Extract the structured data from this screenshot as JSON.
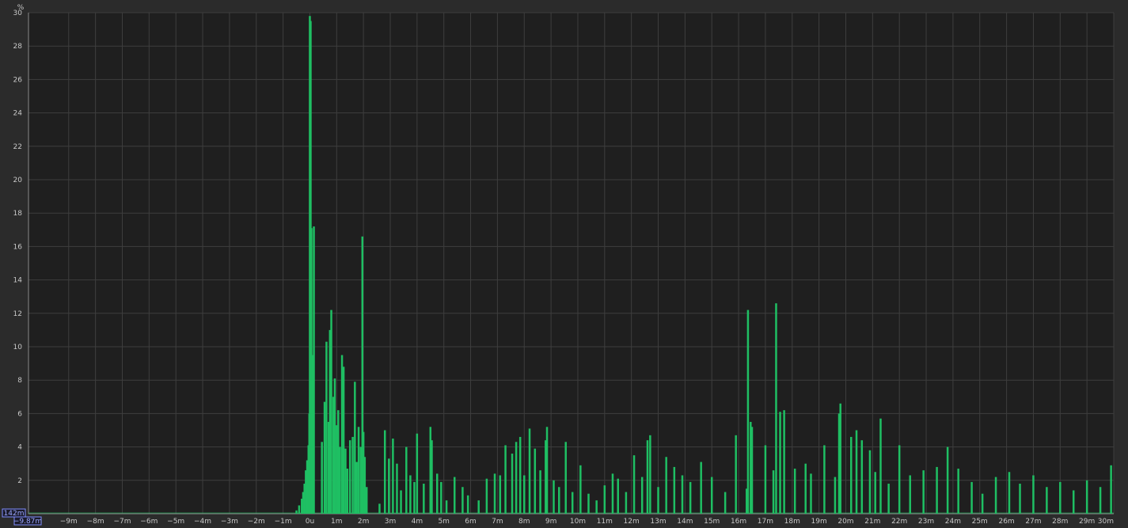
{
  "colors": {
    "background": "#2b2b2b",
    "plot_background": "#1f1f1f",
    "grid": "#3e3e3e",
    "trace": "#1fbf63",
    "cursor": "#7f8cff"
  },
  "readouts": {
    "y_cursor": "142m",
    "x_cursor": "−9.87m"
  },
  "chart_data": {
    "type": "bar",
    "title": "",
    "xlabel": "",
    "ylabel": "%",
    "xlim": [
      -10.5,
      30.0
    ],
    "ylim": [
      0,
      30
    ],
    "grid": true,
    "y_ticks": [
      2,
      4,
      6,
      8,
      10,
      12,
      14,
      16,
      18,
      20,
      22,
      24,
      26,
      28,
      30
    ],
    "x_tick_values": [
      -9,
      -8,
      -7,
      -6,
      -5,
      -4,
      -3,
      -2,
      -1,
      0,
      1,
      2,
      3,
      4,
      5,
      6,
      7,
      8,
      9,
      10,
      11,
      12,
      13,
      14,
      15,
      16,
      17,
      18,
      19,
      20,
      21,
      22,
      23,
      24,
      25,
      26,
      27,
      28,
      29,
      30
    ],
    "x_tick_labels": [
      "−9m",
      "−8m",
      "−7m",
      "−6m",
      "−5m",
      "−4m",
      "−3m",
      "−2m",
      "−1m",
      "0u",
      "1m",
      "2m",
      "3m",
      "4m",
      "5m",
      "6m",
      "7m",
      "8m",
      "9m",
      "10m",
      "11m",
      "12m",
      "13m",
      "14m",
      "15m",
      "16m",
      "17m",
      "18m",
      "19m",
      "20m",
      "21m",
      "22m",
      "23m",
      "24m",
      "25m",
      "26m",
      "27m",
      "28m",
      "29m",
      "30m"
    ],
    "series": [
      {
        "x": [
          -0.5,
          -0.4,
          -0.3,
          -0.25,
          -0.2,
          -0.15,
          -0.1,
          -0.05,
          -0.02,
          0.0,
          0.03,
          0.06,
          0.1,
          0.13,
          0.15,
          0.45,
          0.55,
          0.62,
          0.7,
          0.75,
          0.8,
          0.88,
          0.93,
          1.0,
          1.06,
          1.12,
          1.2,
          1.26,
          1.33,
          1.4,
          1.5,
          1.6,
          1.68,
          1.75,
          1.82,
          1.9,
          1.96,
          2.0,
          2.05,
          2.12,
          2.6,
          2.8,
          2.95,
          3.1,
          3.25,
          3.4,
          3.6,
          3.75,
          3.9,
          4.0,
          4.25,
          4.5,
          4.55,
          4.75,
          4.9,
          5.1,
          5.4,
          5.7,
          5.9,
          6.3,
          6.6,
          6.9,
          7.1,
          7.3,
          7.55,
          7.7,
          7.85,
          8.0,
          8.2,
          8.4,
          8.6,
          8.8,
          8.85,
          9.1,
          9.3,
          9.55,
          9.8,
          10.1,
          10.4,
          10.7,
          11.0,
          11.3,
          11.5,
          11.8,
          12.1,
          12.4,
          12.6,
          12.7,
          13.0,
          13.3,
          13.6,
          13.9,
          14.2,
          14.6,
          15.0,
          15.5,
          15.9,
          16.3,
          16.35,
          16.45,
          16.5,
          17.0,
          17.3,
          17.4,
          17.55,
          17.7,
          18.1,
          18.5,
          18.7,
          19.2,
          19.6,
          19.75,
          19.8,
          20.2,
          20.4,
          20.6,
          20.9,
          21.1,
          21.3,
          21.6,
          22.0,
          22.4,
          22.9,
          23.4,
          23.8,
          24.2,
          24.7,
          25.1,
          25.6,
          26.1,
          26.5,
          27.0,
          27.5,
          28.0,
          28.5,
          29.0,
          29.5,
          29.9
        ],
        "values": [
          0.2,
          0.5,
          0.9,
          1.3,
          1.8,
          2.6,
          3.2,
          4.1,
          6.0,
          29.8,
          29.5,
          17.1,
          9.5,
          6.2,
          17.2,
          4.3,
          6.7,
          10.3,
          5.5,
          11.0,
          12.2,
          7.0,
          8.1,
          5.3,
          6.2,
          4.0,
          9.5,
          8.8,
          3.9,
          2.7,
          4.4,
          4.6,
          7.9,
          3.1,
          5.2,
          4.0,
          16.6,
          4.9,
          3.4,
          1.6,
          0.6,
          5.0,
          3.3,
          4.5,
          3.0,
          1.4,
          4.0,
          2.3,
          1.9,
          4.8,
          1.8,
          5.2,
          4.4,
          2.4,
          1.9,
          0.8,
          2.2,
          1.6,
          1.1,
          0.8,
          2.1,
          2.4,
          2.3,
          4.1,
          3.6,
          4.3,
          4.6,
          2.3,
          5.1,
          3.9,
          2.6,
          4.4,
          5.2,
          2.0,
          1.6,
          4.3,
          1.3,
          2.9,
          1.2,
          0.8,
          1.7,
          2.4,
          2.1,
          1.3,
          3.5,
          2.2,
          4.4,
          4.7,
          1.6,
          3.4,
          2.8,
          2.3,
          1.9,
          3.1,
          2.2,
          1.3,
          4.7,
          1.5,
          12.2,
          5.5,
          5.2,
          4.1,
          2.6,
          12.6,
          6.1,
          6.2,
          2.7,
          3.0,
          2.4,
          4.1,
          2.2,
          6.0,
          6.6,
          4.6,
          5.0,
          4.4,
          3.8,
          2.5,
          5.7,
          1.8,
          4.1,
          2.3,
          2.6,
          2.8,
          4.0,
          2.7,
          1.9,
          1.2,
          2.2,
          2.5,
          1.8,
          2.3,
          1.6,
          1.9,
          1.4,
          2.0,
          1.6,
          2.9
        ]
      }
    ]
  }
}
